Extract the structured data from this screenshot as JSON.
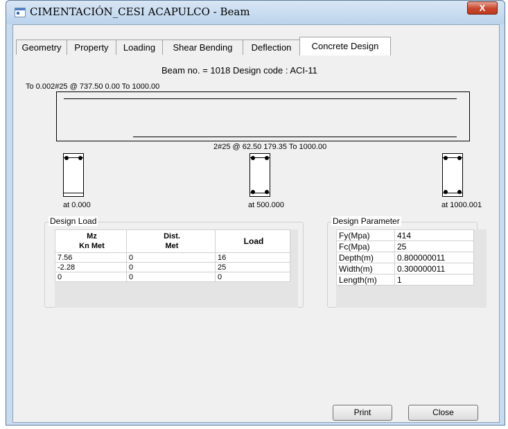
{
  "window": {
    "title": "CIMENTACIÓN_CESI ACAPULCO - Beam",
    "close_glyph": "X"
  },
  "tabs": [
    {
      "label": "Geometry"
    },
    {
      "label": "Property"
    },
    {
      "label": "Loading"
    },
    {
      "label": "Shear Bending"
    },
    {
      "label": "Deflection"
    },
    {
      "label": "Concrete Design",
      "active": true
    }
  ],
  "design": {
    "header": "Beam no. = 1018  Design code :  ACI-11",
    "top_rebar": "To 0.002#25 @ 737.50 0.00 To 1000.00",
    "bottom_rebar": "2#25 @ 62.50 179.35 To 1000.00",
    "sections": [
      {
        "at": "at 0.000"
      },
      {
        "at": "at 500.000"
      },
      {
        "at": "at 1000.001"
      }
    ]
  },
  "design_load": {
    "title": "Design Load",
    "columns": [
      {
        "line1": "Mz",
        "line2": "Kn Met"
      },
      {
        "line1": "Dist.",
        "line2": "Met"
      },
      {
        "line1": "Load",
        "line2": ""
      }
    ],
    "rows": [
      [
        "7.56",
        "0",
        "16"
      ],
      [
        "-2.28",
        "0",
        "25"
      ],
      [
        "0",
        "0",
        "0"
      ]
    ]
  },
  "design_parameter": {
    "title": "Design Parameter",
    "rows": [
      {
        "name": "Fy(Mpa)",
        "value": "414"
      },
      {
        "name": "Fc(Mpa)",
        "value": "25"
      },
      {
        "name": "Depth(m)",
        "value": "0.800000011"
      },
      {
        "name": "Width(m)",
        "value": "0.300000011"
      },
      {
        "name": "Length(m)",
        "value": "1"
      }
    ]
  },
  "buttons": {
    "print": "Print",
    "close": "Close"
  }
}
